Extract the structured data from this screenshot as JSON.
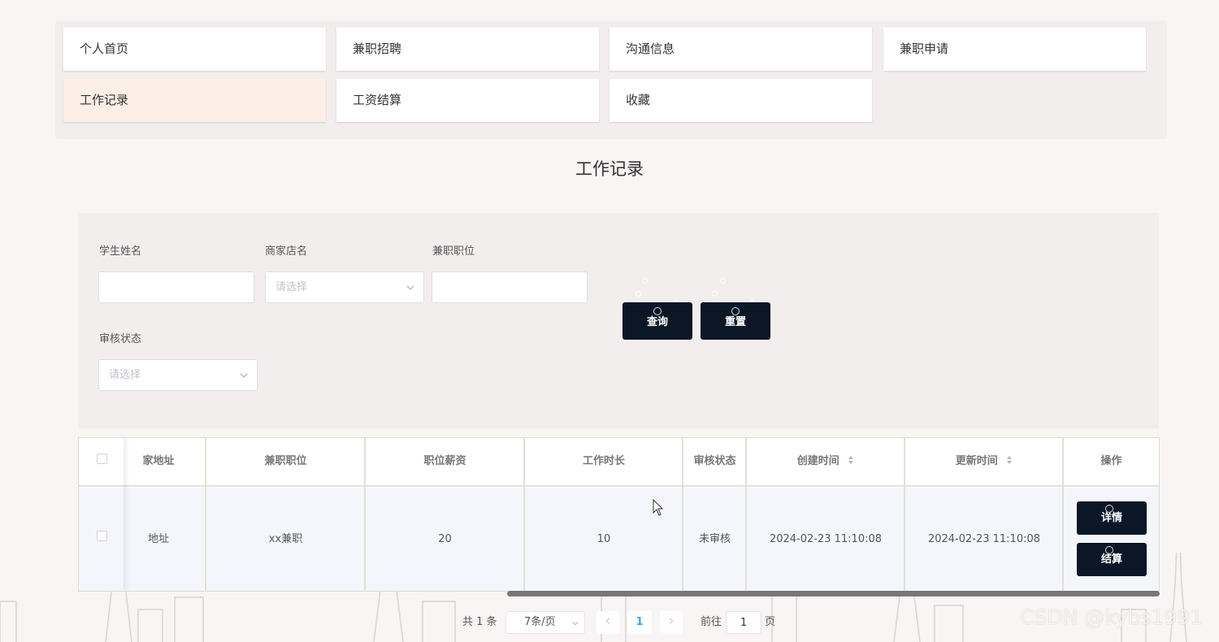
{
  "nav": {
    "items": [
      {
        "label": "个人首页",
        "active": false
      },
      {
        "label": "兼职招聘",
        "active": false
      },
      {
        "label": "沟通信息",
        "active": false
      },
      {
        "label": "兼职申请",
        "active": false
      },
      {
        "label": "工作记录",
        "active": true
      },
      {
        "label": "工资结算",
        "active": false
      },
      {
        "label": "收藏",
        "active": false
      }
    ]
  },
  "page_title": "工作记录",
  "search": {
    "student_name_label": "学生姓名",
    "student_name_value": "",
    "shop_name_label": "商家店名",
    "shop_name_placeholder": "请选择",
    "position_label": "兼职职位",
    "position_value": "",
    "review_status_label": "审核状态",
    "review_status_placeholder": "请选择",
    "query_label": "查询",
    "reset_label": "重置"
  },
  "table": {
    "headers": {
      "address": "家地址",
      "position": "兼职职位",
      "salary": "职位薪资",
      "duration": "工作时长",
      "status": "审核状态",
      "created": "创建时间",
      "updated": "更新时间",
      "actions": "操作"
    },
    "rows": [
      {
        "address": "地址",
        "position": "xx兼职",
        "salary": "20",
        "duration": "10",
        "status": "未审核",
        "created": "2024-02-23 11:10:08",
        "updated": "2024-02-23 11:10:08",
        "detail_label": "详情",
        "settle_label": "结算"
      }
    ]
  },
  "pagination": {
    "total": "共 1 条",
    "page_size": "7条/页",
    "current_page": "1",
    "goto_prefix": "前往",
    "goto_value": "1",
    "goto_suffix": "页"
  },
  "watermark": "CSDN @kybs1991",
  "colors": {
    "button_bg": "#0b1626",
    "active_nav": "#fdeee6",
    "page_bg": "#f8f5f4",
    "link_blue": "#409eff"
  }
}
